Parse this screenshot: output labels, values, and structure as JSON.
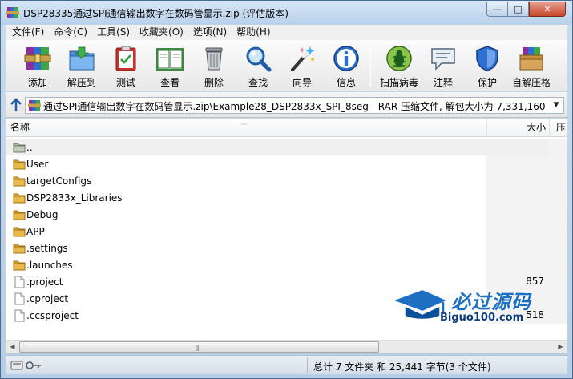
{
  "window": {
    "title": "DSP28335通过SPI通信输出数字在数码管显示.zip (评估版本)",
    "min_glyph": "—",
    "max_glyph": "□",
    "close_glyph": "✕"
  },
  "menu": [
    "文件(F)",
    "命令(C)",
    "工具(S)",
    "收藏夹(O)",
    "选项(N)",
    "帮助(H)"
  ],
  "toolbar": {
    "add": "添加",
    "extract_to": "解压到",
    "test": "测试",
    "view": "查看",
    "delete": "删除",
    "find": "查找",
    "wizard": "向导",
    "info": "信息",
    "virus_scan": "扫描病毒",
    "comment": "注释",
    "protect": "保护",
    "sfx": "自解压格"
  },
  "address": {
    "path": "通过SPI通信输出数字在数码管显示.zip\\Example28_DSP2833x_SPI_8seg - RAR 压缩文件, 解包大小为 7,331,160 字节"
  },
  "columns": {
    "name": "名称",
    "size": "大小",
    "extra": "压"
  },
  "files": [
    {
      "name": "..",
      "size": "",
      "type": "up"
    },
    {
      "name": "User",
      "size": "",
      "type": "folder"
    },
    {
      "name": "targetConfigs",
      "size": "",
      "type": "folder"
    },
    {
      "name": "DSP2833x_Libraries",
      "size": "",
      "type": "folder"
    },
    {
      "name": "Debug",
      "size": "",
      "type": "folder"
    },
    {
      "name": "APP",
      "size": "",
      "type": "folder"
    },
    {
      "name": ".settings",
      "size": "",
      "type": "folder"
    },
    {
      "name": ".launches",
      "size": "",
      "type": "folder"
    },
    {
      "name": ".project",
      "size": "857",
      "type": "file"
    },
    {
      "name": ".cproject",
      "size": "",
      "type": "file"
    },
    {
      "name": ".ccsproject",
      "size": "518",
      "type": "file"
    }
  ],
  "status": {
    "summary": "总计 7 文件夹 和 25,441 字节(3 个文件)"
  },
  "watermark": {
    "brand": "必过源码",
    "site": "Biguo100.com"
  },
  "colors": {
    "folder": "#e8b94a",
    "accent": "#1c6fc1"
  }
}
